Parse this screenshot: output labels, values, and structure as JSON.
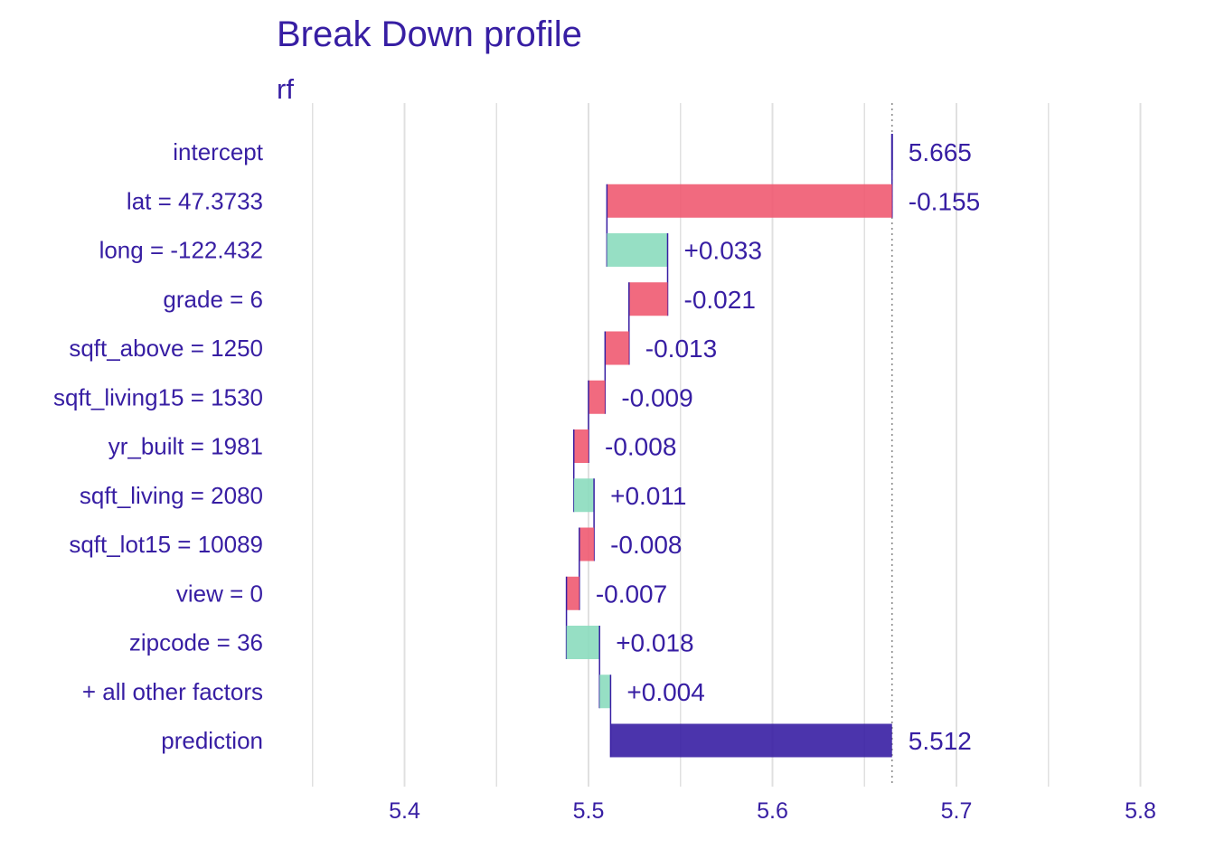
{
  "colors": {
    "text": "#371ea3",
    "positive": "#8bdcbe",
    "negative": "#f05a71",
    "prediction": "#371ea3",
    "grid": "#e0e0e0",
    "background": "#ffffff"
  },
  "chart_data": {
    "type": "bar",
    "subtype": "waterfall",
    "title": "Break Down profile",
    "subtitle": "rf",
    "xlabel": "",
    "ylabel": "",
    "xlim": [
      5.35,
      5.8
    ],
    "grid": true,
    "legend": "none",
    "xticks": [
      {
        "value": 5.4,
        "label": "5.4"
      },
      {
        "value": 5.5,
        "label": "5.5"
      },
      {
        "value": 5.6,
        "label": "5.6"
      },
      {
        "value": 5.7,
        "label": "5.7"
      },
      {
        "value": 5.8,
        "label": "5.8"
      }
    ],
    "reference_line": 5.665,
    "rows": [
      {
        "label": "intercept",
        "start": 5.665,
        "end": 5.665,
        "contribution": 5.665,
        "value_label": "5.665",
        "kind": "intercept"
      },
      {
        "label": "lat = 47.3733",
        "start": 5.665,
        "end": 5.51,
        "contribution": -0.155,
        "value_label": "-0.155",
        "kind": "negative"
      },
      {
        "label": "long = -122.432",
        "start": 5.51,
        "end": 5.543,
        "contribution": 0.033,
        "value_label": "+0.033",
        "kind": "positive"
      },
      {
        "label": "grade = 6",
        "start": 5.543,
        "end": 5.522,
        "contribution": -0.021,
        "value_label": "-0.021",
        "kind": "negative"
      },
      {
        "label": "sqft_above = 1250",
        "start": 5.522,
        "end": 5.509,
        "contribution": -0.013,
        "value_label": "-0.013",
        "kind": "negative"
      },
      {
        "label": "sqft_living15 = 1530",
        "start": 5.509,
        "end": 5.5,
        "contribution": -0.009,
        "value_label": "-0.009",
        "kind": "negative"
      },
      {
        "label": "yr_built = 1981",
        "start": 5.5,
        "end": 5.492,
        "contribution": -0.008,
        "value_label": "-0.008",
        "kind": "negative"
      },
      {
        "label": "sqft_living = 2080",
        "start": 5.492,
        "end": 5.503,
        "contribution": 0.011,
        "value_label": "+0.011",
        "kind": "positive"
      },
      {
        "label": "sqft_lot15 = 10089",
        "start": 5.503,
        "end": 5.495,
        "contribution": -0.008,
        "value_label": "-0.008",
        "kind": "negative"
      },
      {
        "label": "view = 0",
        "start": 5.495,
        "end": 5.488,
        "contribution": -0.007,
        "value_label": "-0.007",
        "kind": "negative"
      },
      {
        "label": "zipcode = 36",
        "start": 5.488,
        "end": 5.506,
        "contribution": 0.018,
        "value_label": "+0.018",
        "kind": "positive"
      },
      {
        "label": "+ all other factors",
        "start": 5.506,
        "end": 5.512,
        "contribution": 0.004,
        "value_label": "+0.004",
        "kind": "positive"
      },
      {
        "label": "prediction",
        "start": 5.665,
        "end": 5.512,
        "contribution": 5.512,
        "value_label": "5.512",
        "kind": "prediction"
      }
    ]
  }
}
